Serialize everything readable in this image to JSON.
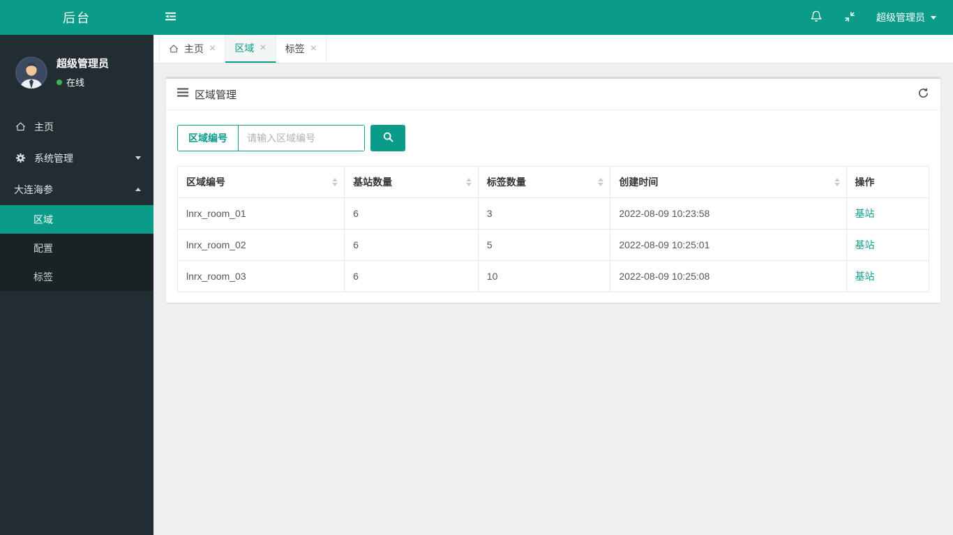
{
  "brand": {
    "title": "后台"
  },
  "topbar": {
    "user_label": "超级管理员",
    "icons": {
      "notifications": "bell-icon",
      "fullscreen": "compress-icon",
      "toggle": "outdent-icon"
    }
  },
  "sidebar": {
    "user": {
      "name": "超级管理员",
      "status_label": "在线"
    },
    "items": [
      {
        "label": "主页",
        "icon": "home-icon"
      },
      {
        "label": "系统管理",
        "icon": "gear-icon",
        "caret": "down"
      },
      {
        "label": "大连海参",
        "caret": "up"
      }
    ],
    "submenu": [
      {
        "label": "区域",
        "active": true
      },
      {
        "label": "配置",
        "active": false
      },
      {
        "label": "标签",
        "active": false
      }
    ]
  },
  "tabs": [
    {
      "label": "主页",
      "icon": "home-icon",
      "active": false
    },
    {
      "label": "区域",
      "active": true
    },
    {
      "label": "标签",
      "active": false
    }
  ],
  "panel": {
    "title": "区域管理",
    "search": {
      "field_label": "区域编号",
      "placeholder": "请输入区域编号"
    },
    "table": {
      "columns": [
        {
          "label": "区域编号",
          "sortable": true
        },
        {
          "label": "基站数量",
          "sortable": true
        },
        {
          "label": "标签数量",
          "sortable": true
        },
        {
          "label": "创建时间",
          "sortable": true
        },
        {
          "label": "操作",
          "sortable": false
        }
      ],
      "rows": [
        [
          "lnrx_room_01",
          "6",
          "3",
          "2022-08-09 10:23:58",
          "基站"
        ],
        [
          "lnrx_room_02",
          "6",
          "5",
          "2022-08-09 10:25:01",
          "基站"
        ],
        [
          "lnrx_room_03",
          "6",
          "10",
          "2022-08-09 10:25:08",
          "基站"
        ]
      ]
    }
  },
  "colors": {
    "accent": "#0b9b89",
    "sidebar_bg": "#222d32",
    "submenu_bg": "#1a2226",
    "status_online": "#3db35a",
    "content_bg": "#efefef"
  }
}
